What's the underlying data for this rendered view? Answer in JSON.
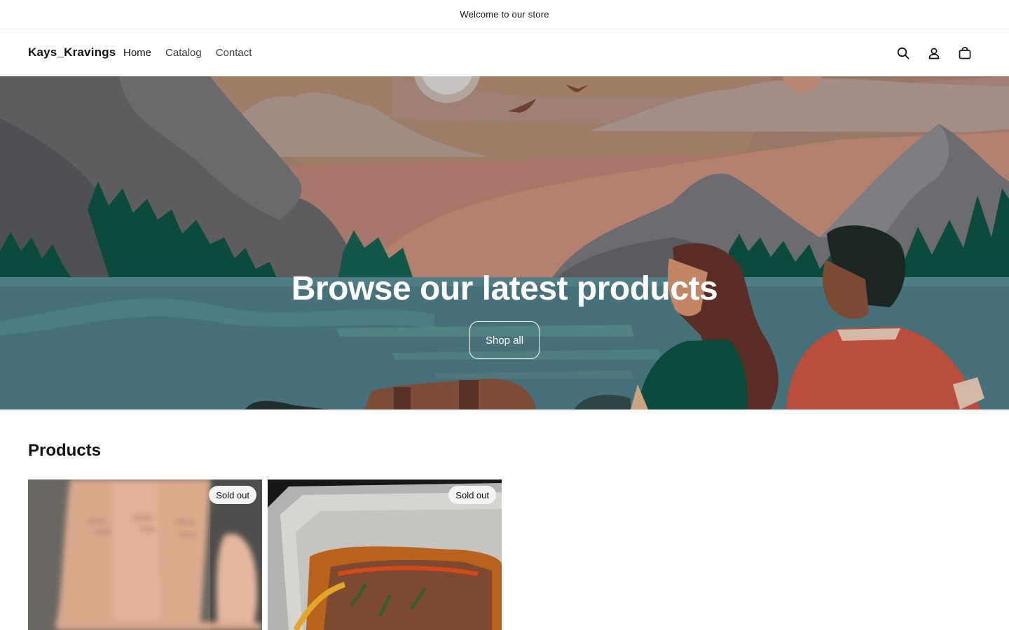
{
  "announcement": {
    "text": "Welcome to our store"
  },
  "header": {
    "logo": "Kays_Kravings",
    "nav": [
      {
        "label": "Home"
      },
      {
        "label": "Catalog"
      },
      {
        "label": "Contact"
      }
    ],
    "icons": [
      "search-icon",
      "account-icon",
      "cart-icon"
    ]
  },
  "hero": {
    "title": "Browse our latest products",
    "button_label": "Shop all"
  },
  "products": {
    "heading": "Products",
    "items": [
      {
        "image": "hand-photo",
        "badge": "Sold out"
      },
      {
        "image": "food-tray-photo",
        "badge": "Sold out"
      }
    ]
  },
  "colors": {
    "text": "#121212",
    "water": "#46717a",
    "forest": "#0c4a3d",
    "badge_bg": "#f3f3f3"
  }
}
